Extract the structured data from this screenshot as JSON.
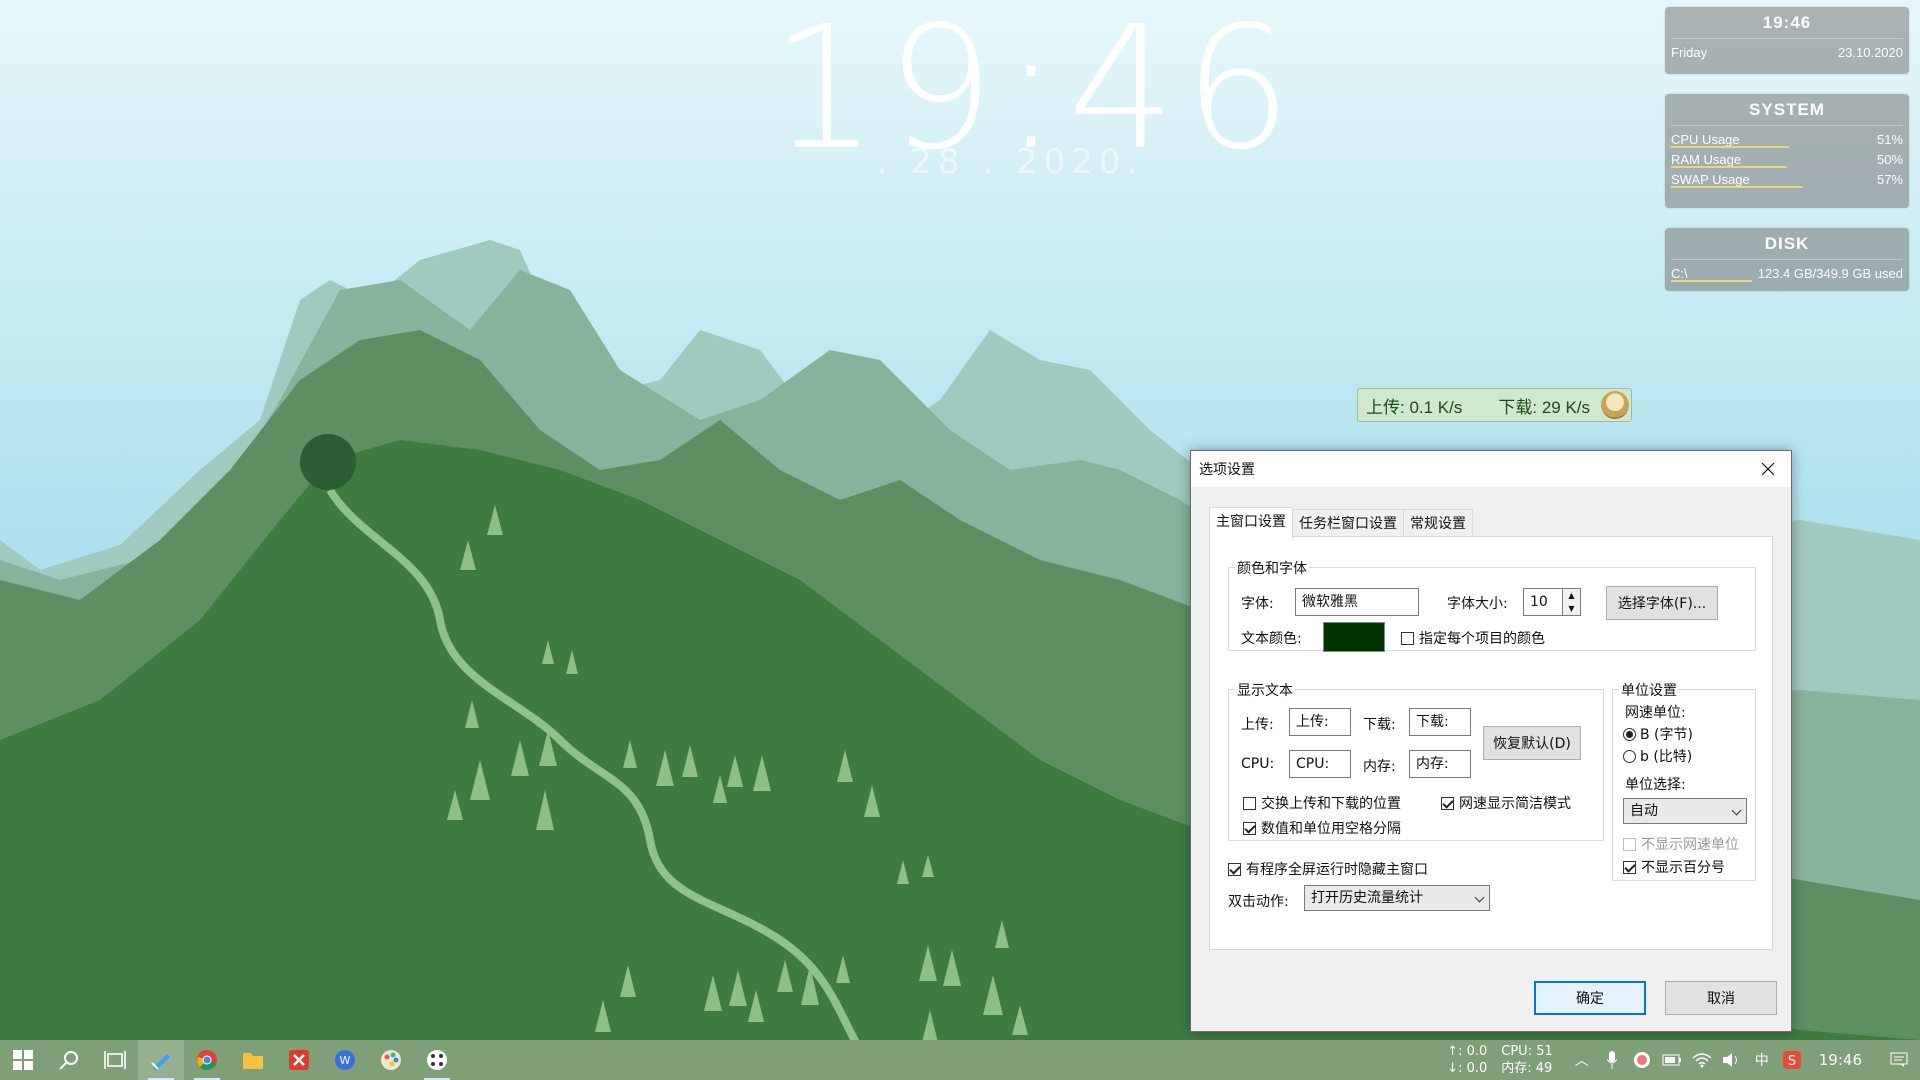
{
  "desktop": {
    "clock_time": "19:46",
    "clock_date": ". 28 . 2020."
  },
  "widgets": {
    "time": {
      "time": "19:46",
      "day": "Friday",
      "date": "23.10.2020"
    },
    "system": {
      "title": "SYSTEM",
      "rows": [
        {
          "label": "CPU Usage",
          "value": "51%",
          "level": 0.51
        },
        {
          "label": "RAM Usage",
          "value": "50%",
          "level": 0.5
        },
        {
          "label": "SWAP Usage",
          "value": "57%",
          "level": 0.57
        }
      ]
    },
    "disk": {
      "title": "DISK",
      "drive": "C:\\",
      "usage": "123.4 GB/349.9 GB used",
      "level": 0.35
    }
  },
  "netspeed": {
    "upload": "上传: 0.1 K/s",
    "download": "下载: 29 K/s"
  },
  "dialog": {
    "title": "选项设置",
    "tabs": [
      "主窗口设置",
      "任务栏窗口设置",
      "常规设置"
    ],
    "color_font": {
      "legend": "颜色和字体",
      "font_label": "字体:",
      "font_value": "微软雅黑",
      "size_label": "字体大小:",
      "size_value": "10",
      "choose_font_btn": "选择字体(F)...",
      "text_color_label": "文本颜色:",
      "text_color": "#003300",
      "per_item_color": "指定每个项目的颜色"
    },
    "display_text": {
      "legend": "显示文本",
      "upload_label": "上传:",
      "upload_value": "上传:",
      "download_label": "下载:",
      "download_value": "下载:",
      "cpu_label": "CPU:",
      "cpu_value": "CPU:",
      "mem_label": "内存:",
      "mem_value": "内存:",
      "restore_btn": "恢复默认(D)",
      "swap_pos": "交换上传和下载的位置",
      "compact_mode": "网速显示简洁模式",
      "space_sep": "数值和单位用空格分隔"
    },
    "unit": {
      "legend": "单位设置",
      "net_unit_label": "网速单位:",
      "opt_byte": "B (字节)",
      "opt_bit": "b (比特)",
      "unit_select_label": "单位选择:",
      "unit_select_value": "自动",
      "hide_net_unit": "不显示网速单位",
      "hide_percent": "不显示百分号"
    },
    "hide_fullscreen": "有程序全屏运行时隐藏主窗口",
    "dblclick_label": "双击动作:",
    "dblclick_value": "打开历史流量统计",
    "ok_btn": "确定",
    "cancel_btn": "取消"
  },
  "taskbar": {
    "stats": {
      "up": "↑: 0.0",
      "cpu": "CPU: 51",
      "down": "↓: 0.0",
      "mem": "内存: 49"
    },
    "ime": "中",
    "time": "19:46"
  }
}
